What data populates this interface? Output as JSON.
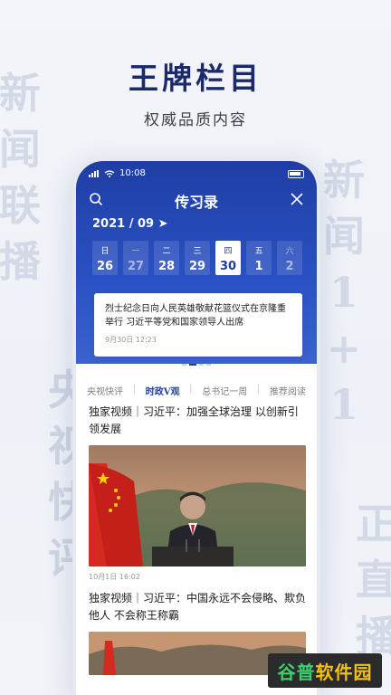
{
  "hero": {
    "title": "王牌栏目",
    "subtitle": "权威品质内容"
  },
  "background_words": {
    "left_top": [
      "新",
      "闻",
      "联",
      "播"
    ],
    "left_bottom": [
      "央",
      "视",
      "快",
      "评"
    ],
    "right_top": [
      "新",
      "闻",
      "1",
      "+",
      "1"
    ],
    "right_bottom": [
      "正",
      "直",
      "播"
    ]
  },
  "status_bar": {
    "time": "10:08"
  },
  "app": {
    "title": "传习录",
    "month_label": "2021 / 09 ➤",
    "days": [
      {
        "weekday": "日",
        "date": "26",
        "state": "normal"
      },
      {
        "weekday": "一",
        "date": "27",
        "state": "muted"
      },
      {
        "weekday": "二",
        "date": "28",
        "state": "normal"
      },
      {
        "weekday": "三",
        "date": "29",
        "state": "normal"
      },
      {
        "weekday": "四",
        "date": "30",
        "state": "active"
      },
      {
        "weekday": "五",
        "date": "1",
        "state": "normal"
      },
      {
        "weekday": "六",
        "date": "2",
        "state": "muted"
      }
    ],
    "featured": {
      "title": "烈士纪念日向人民英雄敬献花篮仪式在京隆重举行 习近平等党和国家领导人出席",
      "time": "9月30日 12:23"
    },
    "tabs": [
      "央视快评",
      "时政V观",
      "总书记一周",
      "推荐阅读"
    ],
    "active_tab": "时政V观",
    "news": [
      {
        "title": "独家视频｜习近平：加强全球治理 以创新引领发展",
        "time": "10月1日 16:02"
      },
      {
        "title": "独家视频｜习近平：中国永远不会侵略、欺负他人 不会称王称霸",
        "time": ""
      }
    ]
  },
  "watermark": {
    "part1": "谷普",
    "part2": "软件园"
  },
  "colors": {
    "brand_blue": "#1f3ea4",
    "hero_title": "#1b2a6b",
    "watermark_green": "#3bd16f",
    "watermark_yellow": "#f5c400"
  }
}
